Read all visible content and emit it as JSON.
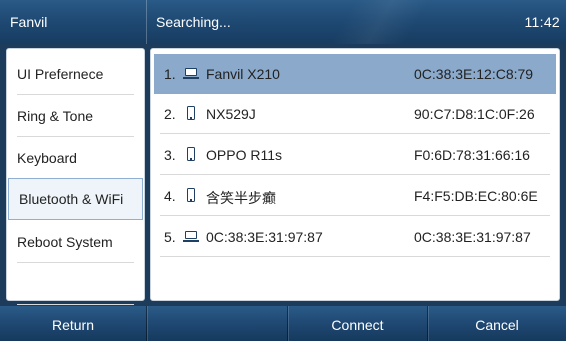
{
  "header": {
    "brand": "Fanvil",
    "status": "Searching...",
    "clock": "11:42"
  },
  "sidebar": {
    "items": [
      {
        "label": "UI Prefernece"
      },
      {
        "label": "Ring & Tone"
      },
      {
        "label": "Keyboard"
      },
      {
        "label": "Bluetooth & WiFi",
        "selected": true
      },
      {
        "label": "Reboot System"
      }
    ]
  },
  "devices": [
    {
      "index": "1.",
      "icon": "laptop-icon",
      "name": "Fanvil X210",
      "mac": "0C:38:3E:12:C8:79",
      "selected": true
    },
    {
      "index": "2.",
      "icon": "phone-icon",
      "name": "NX529J",
      "mac": "90:C7:D8:1C:0F:26"
    },
    {
      "index": "3.",
      "icon": "phone-icon",
      "name": "OPPO R11s",
      "mac": "F0:6D:78:31:66:16"
    },
    {
      "index": "4.",
      "icon": "phone-icon",
      "name": "含笑半步癫",
      "mac": "F4:F5:DB:EC:80:6E"
    },
    {
      "index": "5.",
      "icon": "laptop-icon",
      "name": "0C:38:3E:31:97:87",
      "mac": "0C:38:3E:31:97:87"
    }
  ],
  "softkeys": {
    "key1": "Return",
    "key2": "",
    "key3": "Connect",
    "key4": "Cancel"
  },
  "colors": {
    "header_bg": "#1f4a74",
    "selected_row": "#8aa9cb",
    "icon": "#1f3f63"
  }
}
